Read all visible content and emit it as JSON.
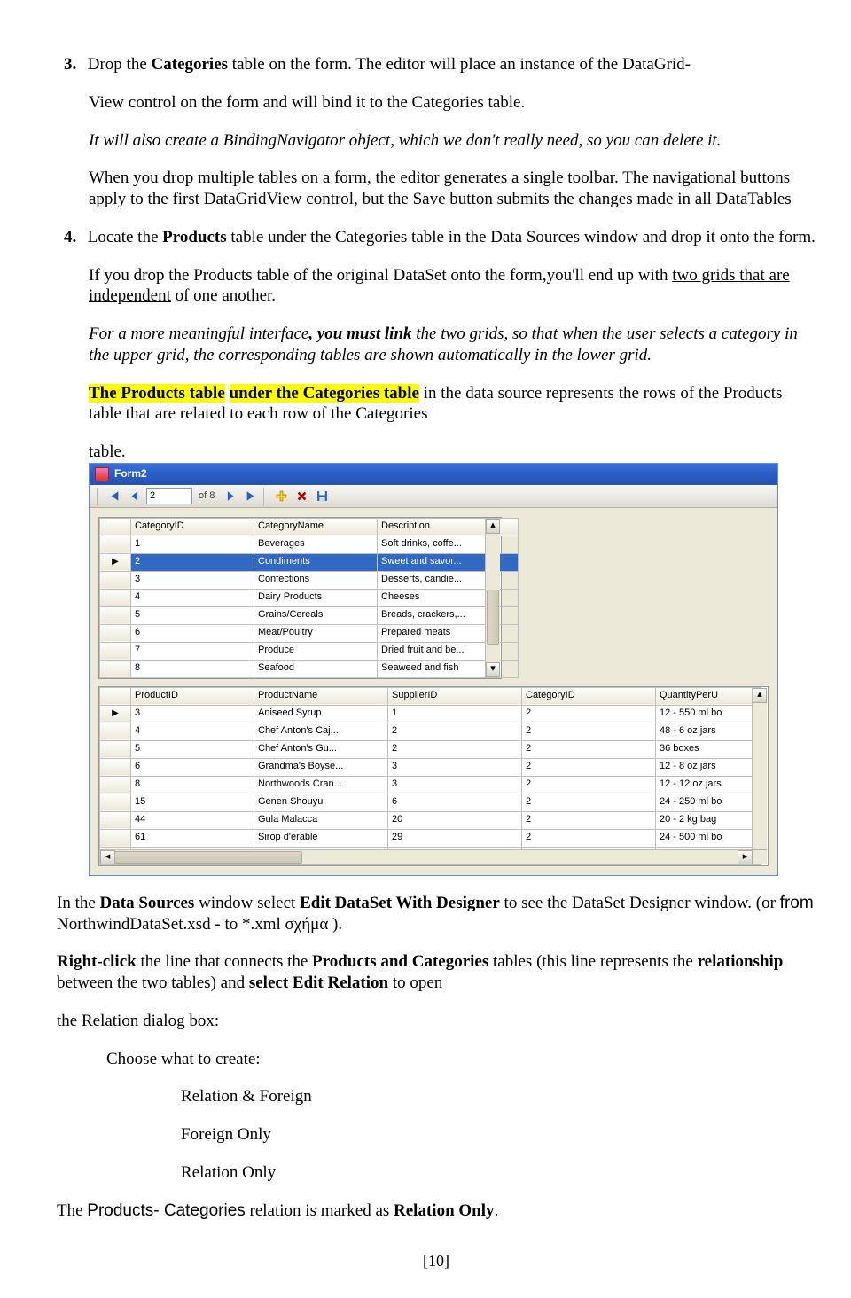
{
  "step3": {
    "num": "3.",
    "line1a": " Drop the ",
    "line1b": "Categories",
    "line1c": " table on the form. The editor will place an instance of the DataGrid-",
    "line2": "View control on the form and will bind it to the Categories table.",
    "line3": "It will also create a BindingNavigator object, which we don't really need, so you can delete it.",
    "line4": "When you drop multiple tables on a form, the editor generates a single toolbar. The navigational buttons apply to the first DataGridView control, but the Save button submits the changes made in all DataTables"
  },
  "step4": {
    "num": "4.",
    "line1a": " Locate the ",
    "line1b": "Products",
    "line1c": " table under the Categories table in the Data Sources window and drop it onto the form.",
    "line2a": "If you drop the Products table of the original DataSet onto the form,you'll end up with ",
    "line2u": "two grids that are independent",
    "line2b": " of one another.",
    "line3a": "For a more meaningful interface",
    "line3b": ", you must link",
    "line3c": " the two grids, so that when the user selects a category in the upper grid, the corresponding tables are shown automatically in the lower grid.",
    "hl1": "The Products table",
    "hl2": "under the Categories table",
    "line4b": " in the data source represents the rows of the Products table that are related to each row of the Categories",
    "tableword": "table."
  },
  "form": {
    "title": "Form2",
    "nav": {
      "pos": "2",
      "of": "of 8"
    },
    "categories": {
      "headers": [
        "CategoryID",
        "CategoryName",
        "Description"
      ],
      "rows": [
        {
          "id": "1",
          "name": "Beverages",
          "desc": "Soft drinks, coffe..."
        },
        {
          "id": "2",
          "name": "Condiments",
          "desc": "Sweet and savor...",
          "selected": true
        },
        {
          "id": "3",
          "name": "Confections",
          "desc": "Desserts, candie..."
        },
        {
          "id": "4",
          "name": "Dairy Products",
          "desc": "Cheeses"
        },
        {
          "id": "5",
          "name": "Grains/Cereals",
          "desc": "Breads, crackers,..."
        },
        {
          "id": "6",
          "name": "Meat/Poultry",
          "desc": "Prepared meats"
        },
        {
          "id": "7",
          "name": "Produce",
          "desc": "Dried fruit and be..."
        },
        {
          "id": "8",
          "name": "Seafood",
          "desc": "Seaweed and fish"
        }
      ]
    },
    "products": {
      "headers": [
        "ProductID",
        "ProductName",
        "SupplierID",
        "CategoryID",
        "QuantityPerU"
      ],
      "rows": [
        {
          "pid": "3",
          "pname": "Aniseed Syrup",
          "sup": "1",
          "cat": "2",
          "qpu": "12 - 550 ml bo",
          "cursor": true
        },
        {
          "pid": "4",
          "pname": "Chef Anton's Caj...",
          "sup": "2",
          "cat": "2",
          "qpu": "48 - 6 oz jars"
        },
        {
          "pid": "5",
          "pname": "Chef Anton's Gu...",
          "sup": "2",
          "cat": "2",
          "qpu": "36 boxes"
        },
        {
          "pid": "6",
          "pname": "Grandma's Boyse...",
          "sup": "3",
          "cat": "2",
          "qpu": "12 - 8 oz jars"
        },
        {
          "pid": "8",
          "pname": "Northwoods Cran...",
          "sup": "3",
          "cat": "2",
          "qpu": "12 - 12 oz jars"
        },
        {
          "pid": "15",
          "pname": "Genen Shouyu",
          "sup": "6",
          "cat": "2",
          "qpu": "24 - 250 ml bo"
        },
        {
          "pid": "44",
          "pname": "Gula Malacca",
          "sup": "20",
          "cat": "2",
          "qpu": "20 - 2 kg bag"
        },
        {
          "pid": "61",
          "pname": "Sirop d'érable",
          "sup": "29",
          "cat": "2",
          "qpu": "24 - 500 ml bo"
        }
      ]
    }
  },
  "after": {
    "p1a": "In the ",
    "p1b": "Data Sources",
    "p1c": " window select ",
    "p1d": "Edit DataSet With Designer",
    "p1e": " to see the DataSet Designer window. (or ",
    "p1f": "from",
    "p1g": " NorthwindDataSet.xsd  - to *.xml σχήμα ).",
    "p2a": "Right-click",
    "p2b": " the line that connects the ",
    "p2c": "Products and Categories",
    "p2d": " tables (this line represents the ",
    "p2e": "relationship",
    "p2f": " between the two tables) and ",
    "p2g": "select Edit Relation",
    "p2h": " to open",
    "p2i": "the Relation dialog box:",
    "choose": "Choose what to create:",
    "opt1": "Relation & Foreign",
    "opt2": "Foreign Only",
    "opt3": "Relation Only",
    "p3a": "The ",
    "p3b": "Products- Categories",
    "p3c": " relation is marked as ",
    "p3d": "Relation Only",
    "p3e": "."
  },
  "pagenum": "[10]"
}
